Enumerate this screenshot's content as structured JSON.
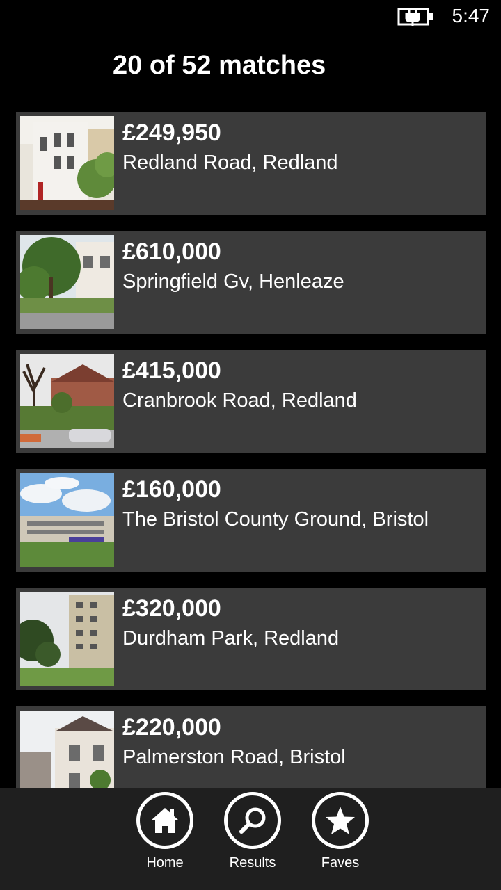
{
  "status_bar": {
    "time": "5:47",
    "battery_icon": "battery-charging-icon"
  },
  "header": {
    "title": "20 of 52 matches"
  },
  "listings": [
    {
      "price": "£249,950",
      "address": "Redland Road, Redland"
    },
    {
      "price": "£610,000",
      "address": "Springfield Gv, Henleaze"
    },
    {
      "price": "£415,000",
      "address": "Cranbrook Road, Redland"
    },
    {
      "price": "£160,000",
      "address": "The Bristol County Ground, Bristol"
    },
    {
      "price": "£320,000",
      "address": "Durdham Park, Redland"
    },
    {
      "price": "£220,000",
      "address": "Palmerston Road, Bristol"
    }
  ],
  "app_bar": {
    "buttons": [
      {
        "label": "Home",
        "icon": "home-icon"
      },
      {
        "label": "Results",
        "icon": "search-icon"
      },
      {
        "label": "Faves",
        "icon": "star-icon"
      }
    ]
  }
}
